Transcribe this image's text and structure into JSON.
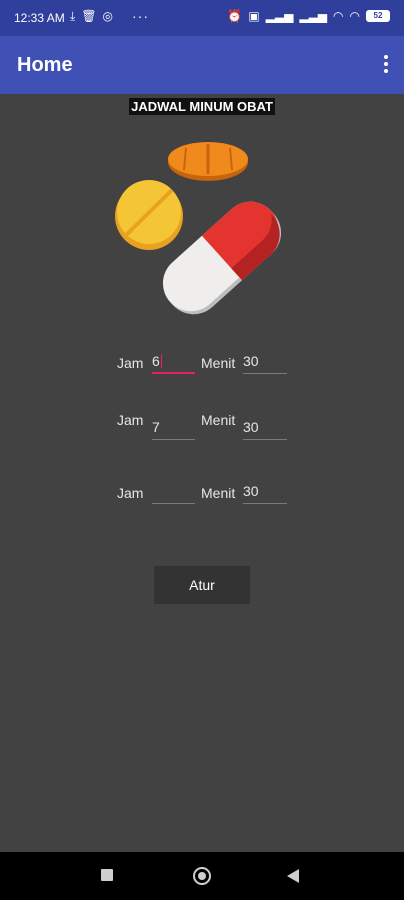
{
  "status_bar": {
    "time": "12:33 AM",
    "left_icons": [
      "download-done-icon",
      "trash-icon",
      "instagram-icon"
    ],
    "more": "···",
    "right_icons": [
      "alarm-off-icon",
      "sim-icon",
      "signal-icon",
      "signal-icon",
      "wifi-icon",
      "wifi-icon"
    ],
    "battery": "52"
  },
  "app_bar": {
    "title": "Home",
    "menu_icon": "more-vert-icon",
    "color": "#3f51b5"
  },
  "main": {
    "heading": "JADWAL MINUM OBAT",
    "image": "pills-illustration",
    "rows": [
      {
        "jam_label": "Jam",
        "jam_value": "6",
        "menit_label": "Menit",
        "menit_value": "30"
      },
      {
        "jam_label": "Jam",
        "jam_value": "7",
        "menit_label": "Menit",
        "menit_value": "30"
      },
      {
        "jam_label": "Jam",
        "jam_value": "",
        "menit_label": "Menit",
        "menit_value": "30"
      }
    ],
    "button_label": "Atur",
    "accent": "#e91e63"
  },
  "nav_bar": {
    "icons": [
      "recents-icon",
      "home-icon",
      "back-icon"
    ]
  }
}
